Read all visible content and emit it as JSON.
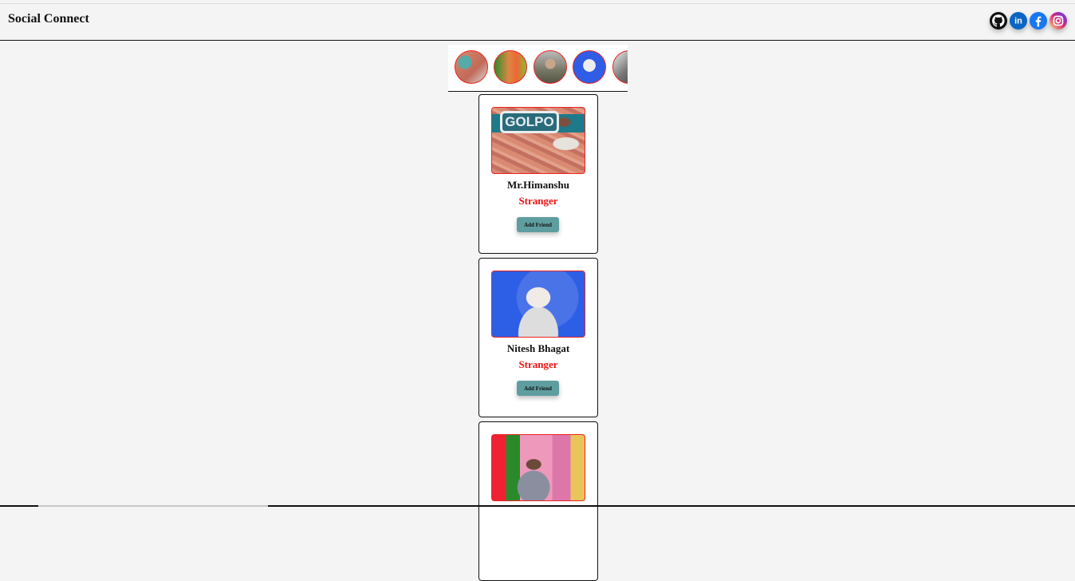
{
  "header": {
    "brand": "Social Connect",
    "socials": [
      {
        "name": "github",
        "icon": "github-icon",
        "color": "#111111"
      },
      {
        "name": "linkedin",
        "icon": "linkedin-icon",
        "color": "#0a66c2"
      },
      {
        "name": "facebook",
        "icon": "facebook-icon",
        "color": "#1877f2"
      },
      {
        "name": "instagram",
        "icon": "instagram-icon",
        "color": "#d62976"
      }
    ]
  },
  "stories": [
    "story-avatar-1",
    "story-avatar-2",
    "story-avatar-3",
    "story-avatar-4",
    "story-avatar-5"
  ],
  "cards": [
    {
      "name": "Mr.Himanshu",
      "status": "Stranger",
      "button": "Add Friend"
    },
    {
      "name": "Nitesh Bhagat",
      "status": "Stranger",
      "button": "Add Friend"
    },
    {
      "name": "",
      "status": "",
      "button": ""
    }
  ],
  "colors": {
    "accent_button": "#5f9ea0",
    "status_red": "#e11111",
    "border_red": "#e22222"
  }
}
